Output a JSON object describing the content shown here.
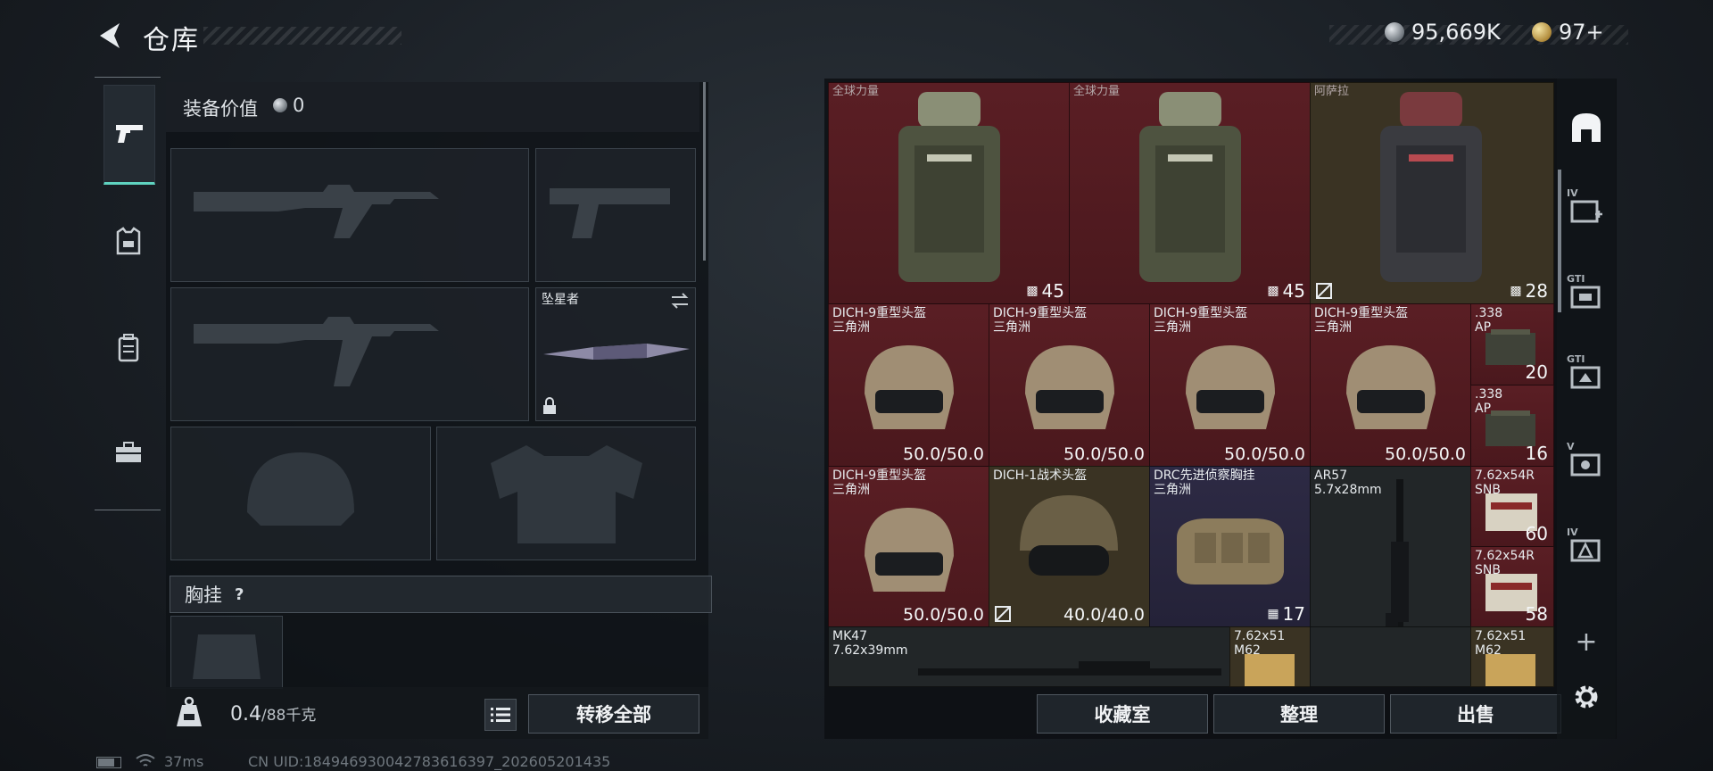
{
  "header": {
    "title": "仓库",
    "silver_amount": "95,669K",
    "gold_amount": "97+"
  },
  "left_tabs": [
    {
      "name": "weapons",
      "icon": "pistol-icon",
      "active": true
    },
    {
      "name": "armor",
      "icon": "vest-icon",
      "active": false
    },
    {
      "name": "backpack",
      "icon": "backpack-icon",
      "active": false
    },
    {
      "name": "supplies",
      "icon": "toolbox-icon",
      "active": false
    }
  ],
  "equipment": {
    "value_label": "装备价值",
    "value": "0",
    "melee_name": "坠星者",
    "chest_section_label": "胸挂",
    "chest_help": "?"
  },
  "bottom_bar": {
    "weight": "0.4",
    "weight_suffix": "/88千克",
    "transfer_all": "转移全部"
  },
  "status_bar": {
    "ping": "37ms",
    "uid": "CN UID:18494693004278361639​7_202605201435"
  },
  "storage_items": [
    {
      "label": "全球力量",
      "count": "45",
      "badge": "bag"
    },
    {
      "label": "全球力量",
      "count": "45",
      "badge": "bag"
    },
    {
      "label": "阿萨拉",
      "count": "28",
      "badge": "bag"
    },
    {
      "label": "DICH-9重型头盔\n三角洲",
      "count": "50.0/50.0"
    },
    {
      "label": "DICH-9重型头盔\n三角洲",
      "count": "50.0/50.0"
    },
    {
      "label": "DICH-9重型头盔\n三角洲",
      "count": "50.0/50.0"
    },
    {
      "label": "DICH-9重型头盔\n三角洲",
      "count": "50.0/50.0"
    },
    {
      "label": ".338\nAP",
      "count": "20"
    },
    {
      "label": ".338\nAP",
      "count": "16"
    },
    {
      "label": "DICH-9重型头盔\n三角洲",
      "count": "50.0/50.0"
    },
    {
      "label": "DICH-1战术头盔",
      "count": "40.0/40.0"
    },
    {
      "label": "DRC先进侦察胸挂\n三角洲",
      "count": "17"
    },
    {
      "label": "AR57\n5.7x28mm",
      "count": ""
    },
    {
      "label": "7.62x54R\nSNB",
      "count": "60"
    },
    {
      "label": "7.62x54R\nSNB",
      "count": "58"
    },
    {
      "label": "MK47\n7.62x39mm",
      "count": ""
    },
    {
      "label": "7.62x51\nM62",
      "count": ""
    },
    {
      "label": "7.62x51\nM62",
      "count": ""
    }
  ],
  "storage_buttons": {
    "collection": "收藏室",
    "organize": "整理",
    "sell": "出售"
  },
  "right_rail": {
    "tags": [
      "IV",
      "GTI",
      "GTI",
      "V",
      "IV"
    ],
    "add": "+"
  },
  "colors": {
    "accent": "#5fd3c0",
    "item_red": "#5a1e24",
    "item_purple": "#2d2a44"
  }
}
